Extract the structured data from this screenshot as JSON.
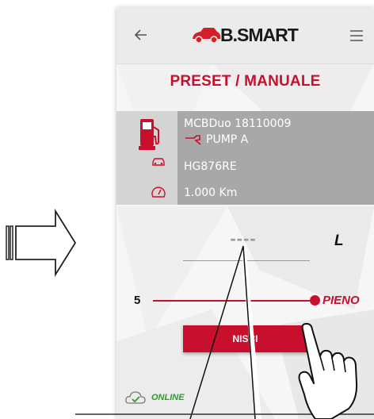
{
  "header": {
    "brand": "B.SMART",
    "back_icon": "arrow-left-icon",
    "menu_icon": "hamburger-menu-icon"
  },
  "screen": {
    "title": "PRESET / MANUALE"
  },
  "info": {
    "device": "MCBDuo 18110009",
    "pump": "PUMP A",
    "plate": "HG876RE",
    "km": "1.000 Km",
    "icons": [
      "fuel-pump-icon",
      "nozzle-icon",
      "car-icon",
      "speedometer-icon"
    ]
  },
  "quantity": {
    "value": "----",
    "unit": "L"
  },
  "slider": {
    "min_label": "5",
    "max_label": "PIENO",
    "position": 1.0
  },
  "actions": {
    "finish_label": "NISCI"
  },
  "status": {
    "label": "ONLINE",
    "icon": "cloud-check-icon"
  },
  "colors": {
    "accent": "#c8102e",
    "online": "#2e9a2e",
    "info_card": "#a8a8a8",
    "header_bg": "#ebebeb"
  }
}
